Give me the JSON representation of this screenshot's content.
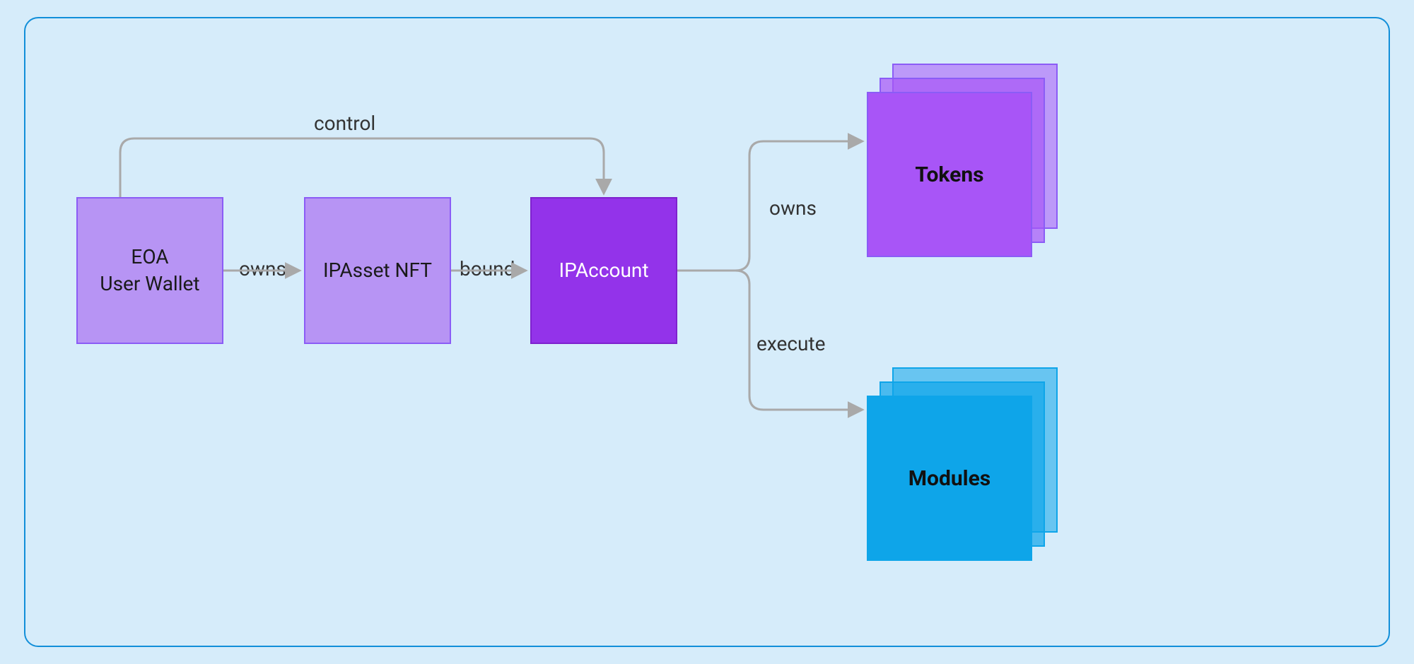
{
  "nodes": {
    "eoa": {
      "line1": "EOA",
      "line2": "User Wallet"
    },
    "nft": "IPAsset NFT",
    "account": "IPAccount",
    "tokens": "Tokens",
    "modules": "Modules"
  },
  "edges": {
    "control": "control",
    "owns1": "owns",
    "bound": "bound",
    "owns2": "owns",
    "execute": "execute"
  },
  "colors": {
    "canvas": "#d6ecfa",
    "frame_border": "#128fd9",
    "purple_light": "#b794f4",
    "purple_border": "#8b5cf6",
    "purple_solid": "#9333ea",
    "stack_purple": "#a855f7",
    "stack_blue": "#0ea5e9",
    "connector": "#a9a9a9"
  }
}
